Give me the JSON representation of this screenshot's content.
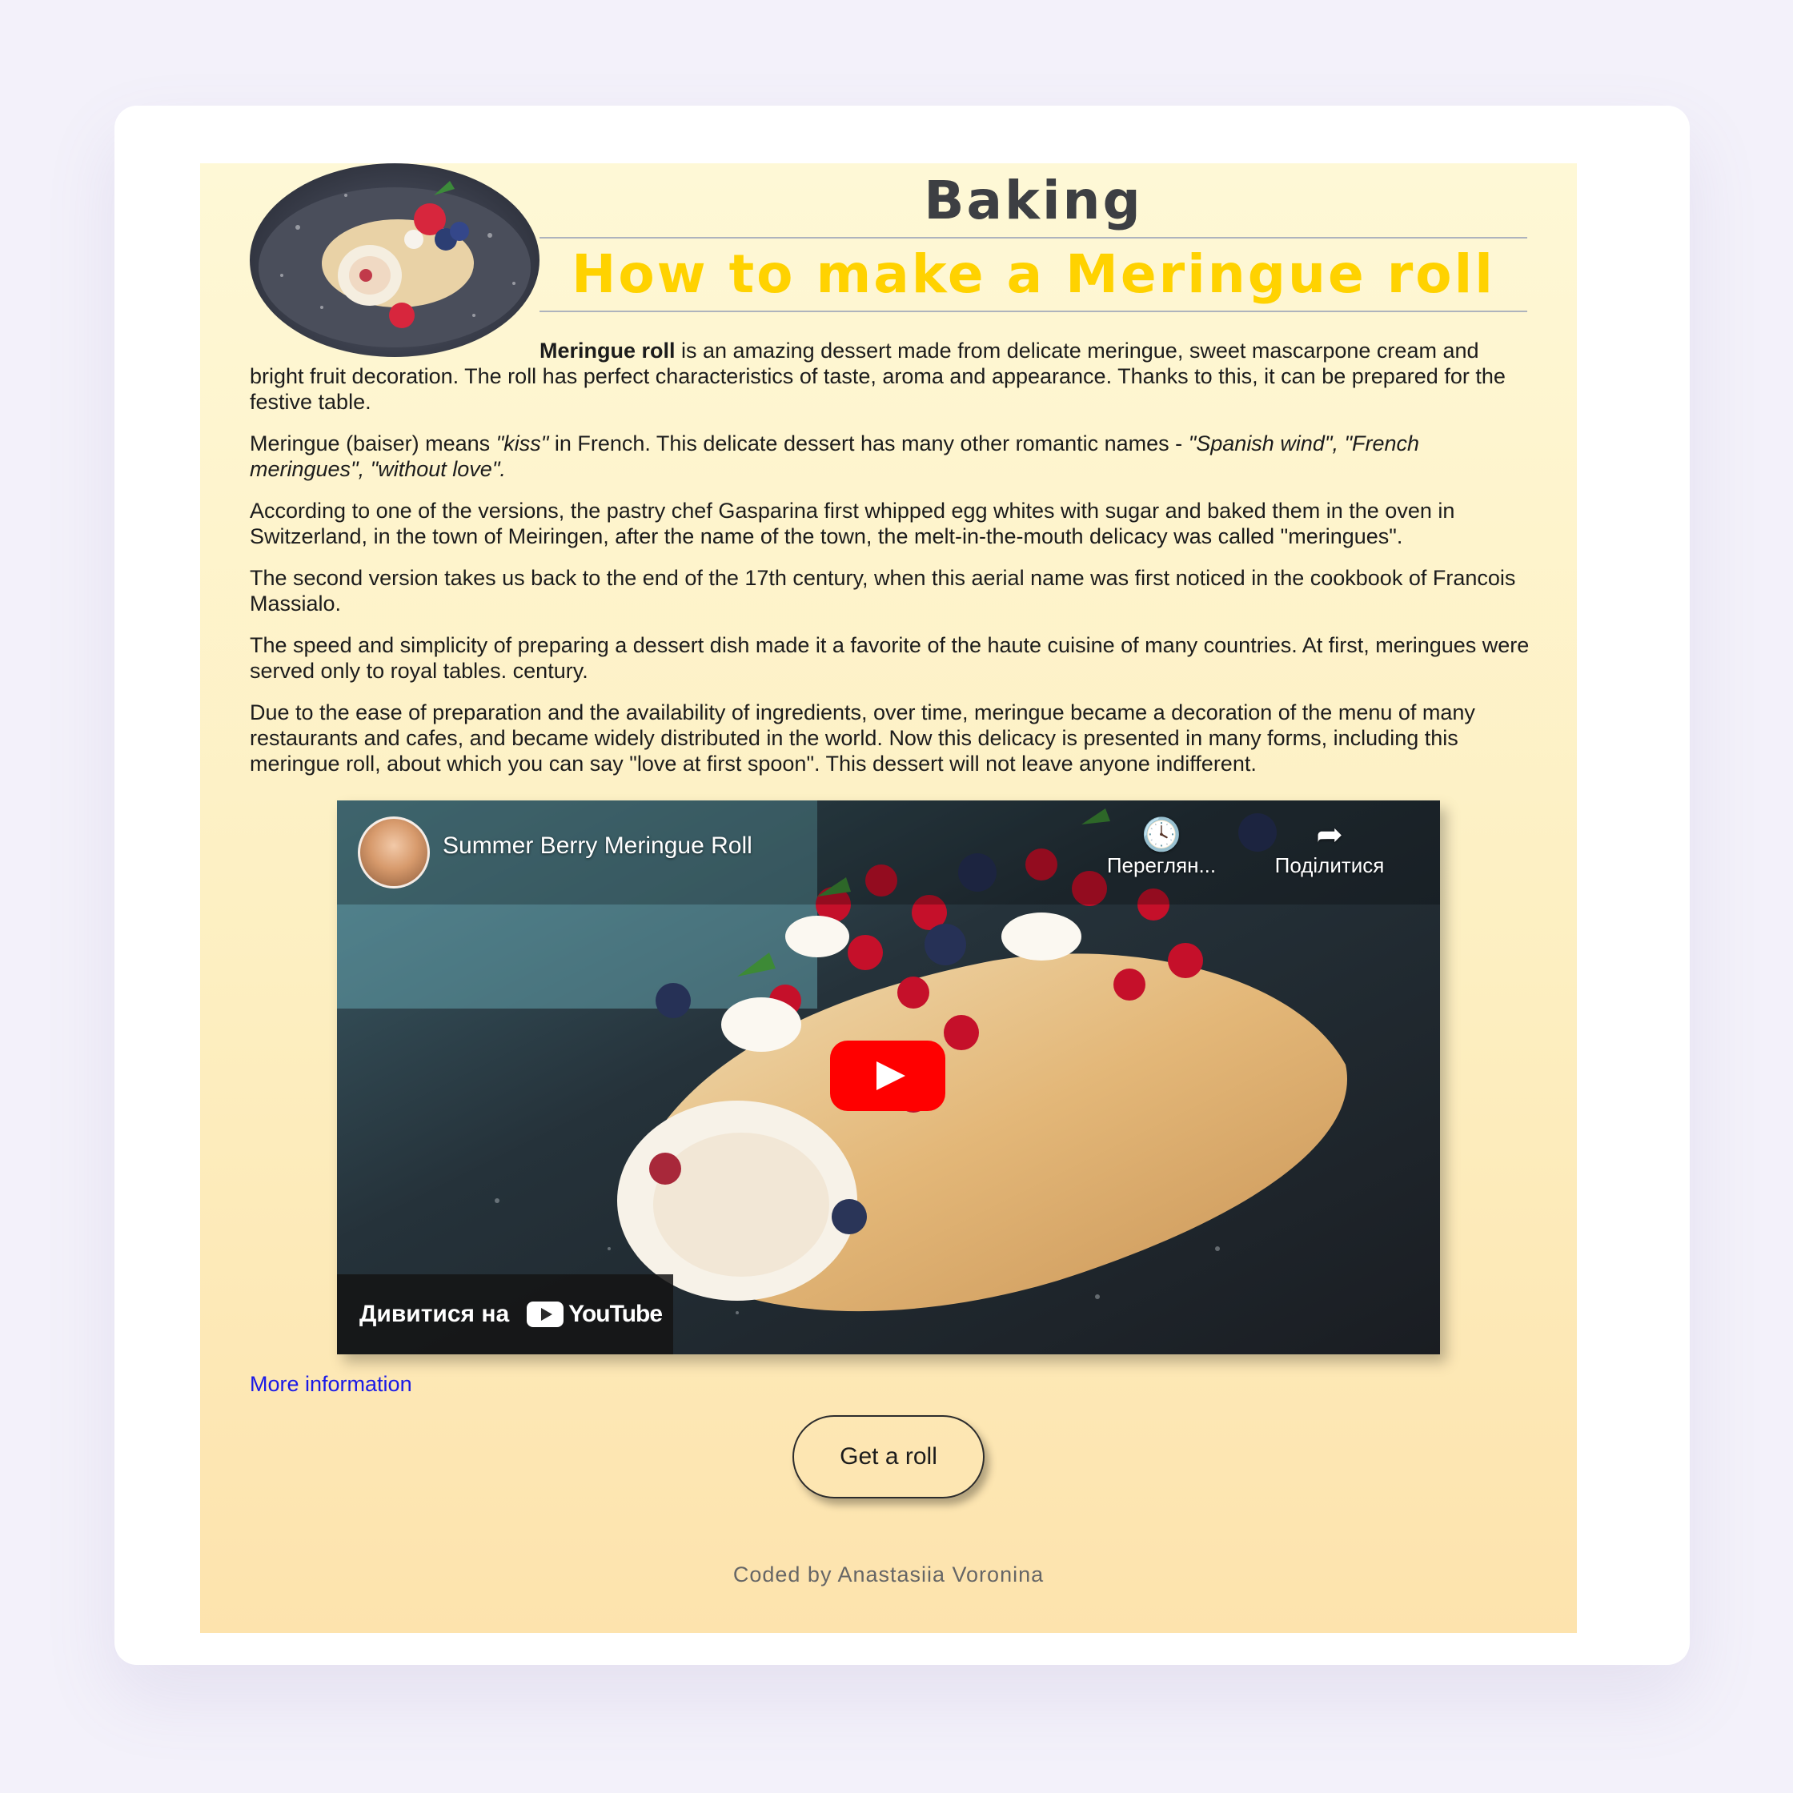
{
  "header": {
    "site_title": "Baking",
    "page_title": "How to make a Meringue roll"
  },
  "article": {
    "p1_bold": "Meringue roll",
    "p1_rest": " is an amazing dessert made from delicate meringue, sweet mascarpone cream and bright fruit decoration. The roll has perfect characteristics of taste, aroma and appearance. Thanks to this, it can be prepared for the festive table.",
    "p2_a": "Meringue (baiser) means ",
    "p2_kiss": "\"kiss\"",
    "p2_b": " in French. This delicate dessert has many other romantic names - ",
    "p2_names": "\"Spanish wind\", \"French meringues\", \"without love\".",
    "p3": "According to one of the versions, the pastry chef Gasparina first whipped egg whites with sugar and baked them in the oven in Switzerland, in the town of Meiringen, after the name of the town, the melt-in-the-mouth delicacy was called \"meringues\".",
    "p4": "The second version takes us back to the end of the 17th century, when this aerial name was first noticed in the cookbook of Francois Massialo.",
    "p5": "The speed and simplicity of preparing a dessert dish made it a favorite of the haute cuisine of many countries. At first, meringues were served only to royal tables. century.",
    "p6": "Due to the ease of preparation and the availability of ingredients, over time, meringue became a decoration of the menu of many restaurants and cafes, and became widely distributed in the world. Now this delicacy is presented in many forms, including this meringue roll, about which you can say \"love at first spoon\". This dessert will not leave anyone indifferent."
  },
  "video": {
    "title": "Summer Berry Meringue Roll",
    "watch_later_label": "Переглян...",
    "share_label": "Поділитися",
    "watch_on_label": "Дивитися на",
    "youtube_label": "YouTube",
    "watch_icon": "clock-icon",
    "share_icon": "share-arrow-icon"
  },
  "links": {
    "more_info": "More information"
  },
  "cta": {
    "label": "Get a roll"
  },
  "footer": {
    "credit": "Coded by Anastasiia Voronina"
  },
  "colors": {
    "page_title": "#ffd200",
    "site_title": "#3d3f43",
    "link": "#1a1ae6",
    "youtube_red": "#ff0000"
  }
}
